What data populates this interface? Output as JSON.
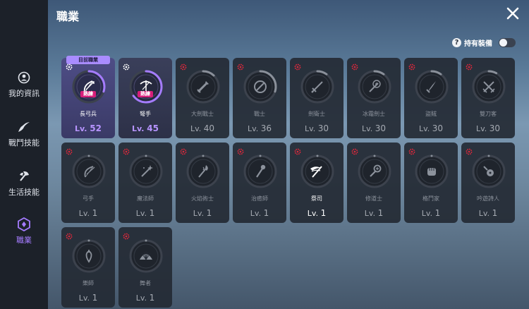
{
  "header": {
    "title": "職業",
    "close_icon": "close-icon"
  },
  "sidebar": {
    "items": [
      {
        "label": "我的資訊",
        "icon": "profile-icon"
      },
      {
        "label": "戰鬥技能",
        "icon": "combat-skill-icon"
      },
      {
        "label": "生活技能",
        "icon": "axe-icon"
      },
      {
        "label": "職業",
        "icon": "class-icon",
        "active": true
      }
    ]
  },
  "filter": {
    "label": "持有裝備",
    "help": "?",
    "enabled": false
  },
  "badge_current": "目前職業",
  "mastery_tag": "熟練",
  "colors": {
    "accent": "#a57cff",
    "badge": "#a98cff",
    "mastery": "#d81e7a",
    "lock": "#d8283c"
  },
  "classes": [
    {
      "name": "長弓兵",
      "lv_prefix": "Lv.",
      "level": "52",
      "icon": "longbow-icon",
      "state": "selected",
      "progress": 0.3
    },
    {
      "name": "弩手",
      "lv_prefix": "Lv.",
      "level": "45",
      "icon": "crossbow-icon",
      "state": "owned",
      "progress": 0.65
    },
    {
      "name": "大劍戰士",
      "lv_prefix": "Lv.",
      "level": "40",
      "icon": "greatsword-icon",
      "state": "locked",
      "progress": 0.12
    },
    {
      "name": "戰士",
      "lv_prefix": "Lv.",
      "level": "36",
      "icon": "shield-sword-icon",
      "state": "locked",
      "progress": 0.3
    },
    {
      "name": "劍衛士",
      "lv_prefix": "Lv.",
      "level": "30",
      "icon": "sword-icon",
      "state": "locked",
      "progress": 0.1
    },
    {
      "name": "冰霜劍士",
      "lv_prefix": "Lv.",
      "level": "30",
      "icon": "frost-sword-icon",
      "state": "locked",
      "progress": 0.1
    },
    {
      "name": "盜賊",
      "lv_prefix": "Lv.",
      "level": "30",
      "icon": "dagger-icon",
      "state": "locked",
      "progress": 0.1
    },
    {
      "name": "雙刀客",
      "lv_prefix": "Lv.",
      "level": "30",
      "icon": "dual-blade-icon",
      "state": "locked",
      "progress": 0.08
    },
    {
      "name": "弓手",
      "lv_prefix": "Lv.",
      "level": "1",
      "icon": "bow-icon",
      "state": "locked",
      "progress": 0
    },
    {
      "name": "魔法師",
      "lv_prefix": "Lv.",
      "level": "1",
      "icon": "wand-icon",
      "state": "locked",
      "progress": 0
    },
    {
      "name": "火焰術士",
      "lv_prefix": "Lv.",
      "level": "1",
      "icon": "fire-staff-icon",
      "state": "locked",
      "progress": 0
    },
    {
      "name": "治癒師",
      "lv_prefix": "Lv.",
      "level": "1",
      "icon": "healing-staff-icon",
      "state": "locked",
      "progress": 0
    },
    {
      "name": "祭司",
      "lv_prefix": "Lv.",
      "level": "1",
      "icon": "winged-staff-icon",
      "state": "bright",
      "progress": 0
    },
    {
      "name": "修道士",
      "lv_prefix": "Lv.",
      "level": "1",
      "icon": "mace-icon",
      "state": "locked",
      "progress": 0
    },
    {
      "name": "格鬥家",
      "lv_prefix": "Lv.",
      "level": "1",
      "icon": "fist-icon",
      "state": "locked",
      "progress": 0
    },
    {
      "name": "吟遊詩人",
      "lv_prefix": "Lv.",
      "level": "1",
      "icon": "lute-icon",
      "state": "locked",
      "progress": 0
    },
    {
      "name": "樂師",
      "lv_prefix": "Lv.",
      "level": "1",
      "icon": "harp-icon",
      "state": "locked",
      "progress": 0
    },
    {
      "name": "舞者",
      "lv_prefix": "Lv.",
      "level": "1",
      "icon": "fan-icon",
      "state": "locked",
      "progress": 0
    }
  ]
}
